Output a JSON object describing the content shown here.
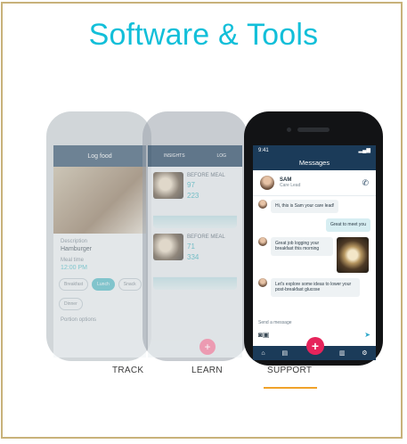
{
  "title": "Software & Tools",
  "tabs": [
    {
      "label": "TRACK",
      "active": false
    },
    {
      "label": "LEARN",
      "active": false
    },
    {
      "label": "SUPPORT",
      "active": true
    }
  ],
  "colors": {
    "accent": "#12bfd9",
    "tab_underline": "#f0a22a",
    "app_header": "#1b3b59",
    "fab": "#e6245b"
  },
  "phone_log": {
    "header": "Log food",
    "description_label": "Description",
    "description_value": "Hamburger",
    "meal_time_label": "Meal time",
    "meal_time_value": "12:00 PM",
    "chips": [
      "Breakfast",
      "Lunch",
      "Snack",
      "Dinner"
    ],
    "portion_label": "Portion options"
  },
  "phone_learn": {
    "tabs": [
      "INSIGHTS",
      "LOG"
    ],
    "meal1": {
      "label": "BEFORE MEAL",
      "before": "97",
      "peak": "223"
    },
    "meal2": {
      "label": "BEFORE MEAL",
      "before": "71",
      "peak": "334"
    }
  },
  "messages_screen": {
    "time": "9:41",
    "header": "Messages",
    "contact_name": "SAM",
    "contact_role": "Care Lead",
    "messages": [
      {
        "from": "them",
        "text": "Hi, this is Sam your care lead!"
      },
      {
        "from": "me",
        "text": "Great to meet you"
      },
      {
        "from": "them",
        "text": "Great job logging your breakfast this morning"
      },
      {
        "from": "them",
        "text": "Let's explore some ideas to lower your post-breakfast glucose"
      }
    ],
    "input_placeholder": "Send a message"
  }
}
